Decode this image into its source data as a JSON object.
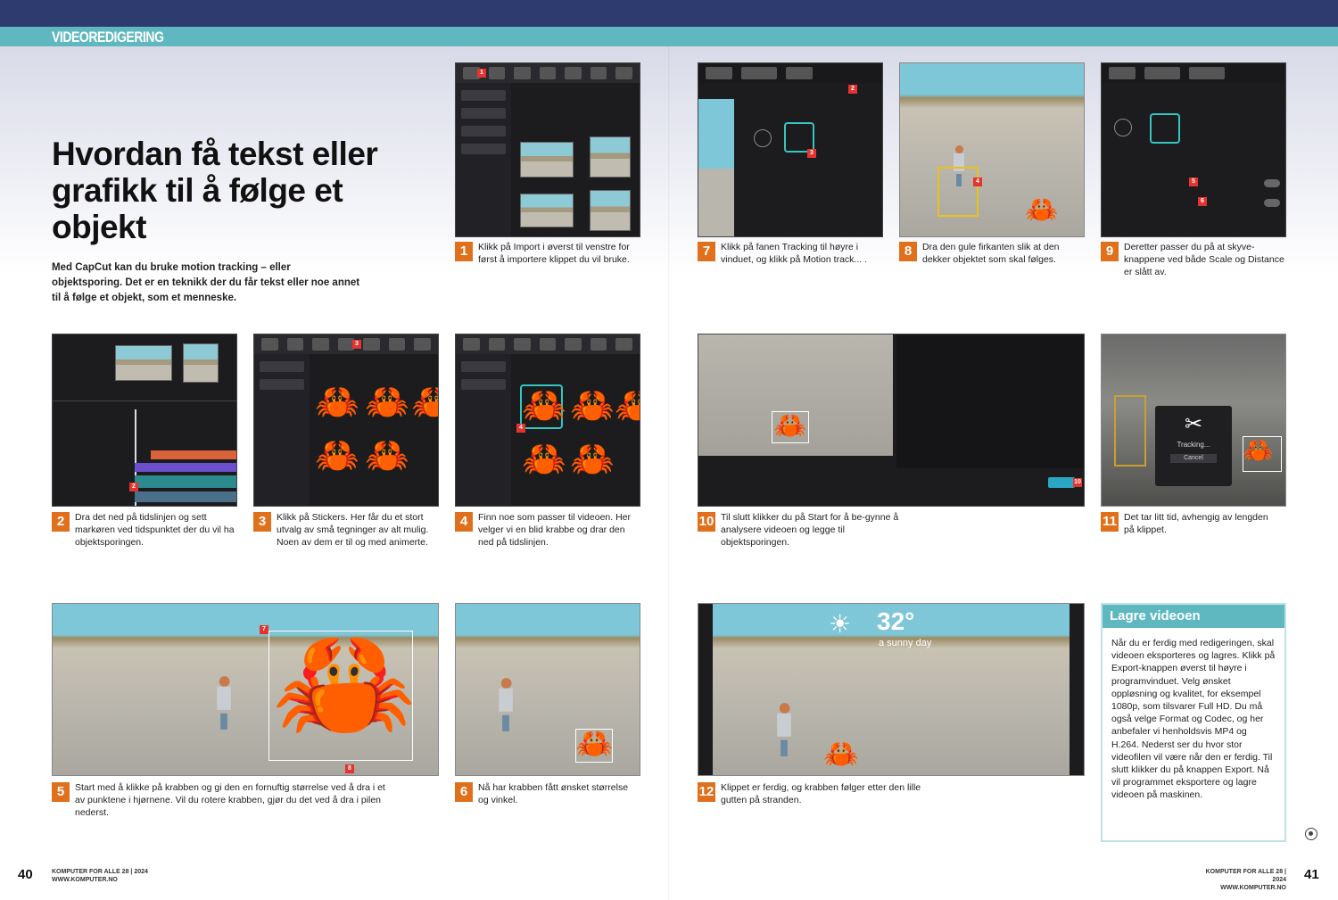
{
  "section_label": "VIDEOREDIGERING",
  "title": "Hvordan få tekst eller grafikk til å følge et objekt",
  "lead": "Med CapCut kan du bruke motion tracking – eller objektsporing. Det er en teknikk der du får tekst eller noe annet til å følge et objekt, som et menneske.",
  "steps": [
    {
      "num": "1",
      "text": "Klikk på Import i øverst til venstre for først å importere klippet du vil bruke."
    },
    {
      "num": "2",
      "text": "Dra det ned på tidslinjen og sett markøren ved tidspunktet der du vil ha objektsporingen."
    },
    {
      "num": "3",
      "text": "Klikk på Stickers. Her får du et stort utvalg av små tegninger av alt mulig. Noen av dem er til og med animerte."
    },
    {
      "num": "4",
      "text": "Finn noe som passer til videoen. Her velger vi en blid krabbe og drar den ned på tidslinjen."
    },
    {
      "num": "5",
      "text": "Start med å klikke på krabben og gi den en fornuftig størrelse ved å dra i et av punktene i hjørnene. Vil du rotere krabben, gjør du det ved å dra i pilen nederst."
    },
    {
      "num": "6",
      "text": "Nå har krabben fått ønsket størrelse og vinkel."
    },
    {
      "num": "7",
      "text": "Klikk på fanen Tracking til høyre i vinduet, og klikk på Motion track... ."
    },
    {
      "num": "8",
      "text": "Dra den gule firkanten slik at den dekker objektet som skal følges."
    },
    {
      "num": "9",
      "text": "Deretter passer du på at skyve-knappene ved både Scale og Distance er slått av."
    },
    {
      "num": "10",
      "text": "Til slutt klikker du på Start for å be-gynne å analysere videoen og legge til objektsporingen."
    },
    {
      "num": "11",
      "text": "Det tar litt tid, avhengig av lengden på klippet."
    },
    {
      "num": "12",
      "text": "Klippet er ferdig, og krabben følger etter den lille gutten på stranden."
    }
  ],
  "sidebox": {
    "title": "Lagre videoen",
    "body": "Når du er ferdig med redigeringen, skal videoen eksporteres og lagres. Klikk på Export-knappen øverst til høyre i programvinduet. Velg ønsket oppløsning og kvalitet, for eksempel 1080p, som tilsvarer Full HD. Du må også velge Format og Codec, og her anbefaler vi henholdsvis MP4 og H.264. Nederst ser du hvor stor videofilen vil være når den er ferdig. Til slutt klikker du på knappen Export. Nå vil programmet eksportere og lagre videoen på maskinen."
  },
  "overlay": {
    "temperature": "32°",
    "weather": "a sunny day",
    "tracking_status": "Tracking...",
    "cancel": "Cancel"
  },
  "folio": {
    "left_page": "40",
    "right_page": "41",
    "left_meta_1": "KOMPUTER FOR ALLE 28 | 2024",
    "left_meta_2": "WWW.KOMPUTER.NO",
    "right_meta_1": "KOMPUTER FOR ALLE 28 | 2024",
    "right_meta_2": "WWW.KOMPUTER.NO"
  },
  "colors": {
    "navy": "#2e3b6e",
    "teal": "#5fb8c0",
    "step_orange": "#e0701c",
    "marker_red": "#e3342f"
  }
}
